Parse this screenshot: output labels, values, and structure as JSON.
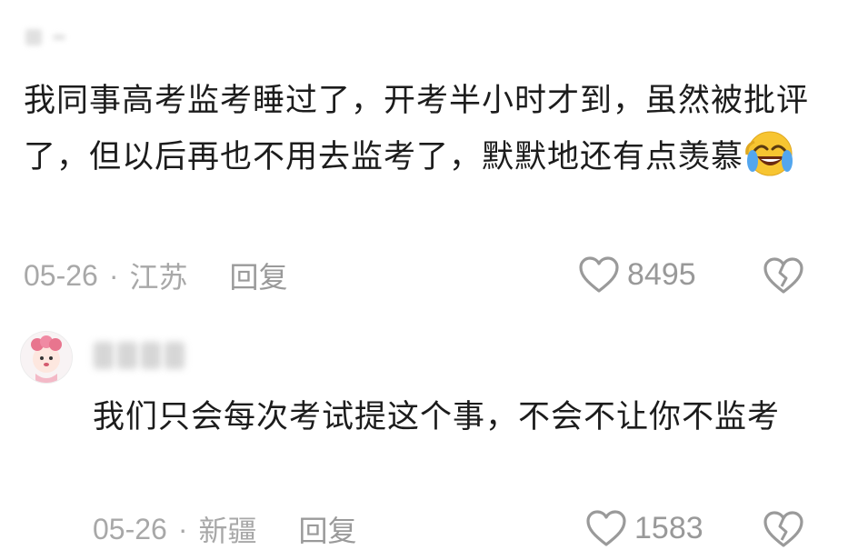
{
  "comment1": {
    "text": "我同事高考监考睡过了，开考半小时才到，虽然被批评了，但以后再也不用去监考了，默默地还有点羡慕",
    "date": "05-26",
    "separator": "·",
    "location": "江苏",
    "reply_label": "回复",
    "like_count": "8495",
    "emoji_icon": "laughing-crying-emoji"
  },
  "comment2": {
    "text": "我们只会每次考试提这个事，不会不让你不监考",
    "date": "05-26",
    "separator": "·",
    "location": "新疆",
    "reply_label": "回复",
    "like_count": "1583"
  },
  "icons": {
    "like": "heart-icon",
    "dislike": "broken-heart-icon"
  },
  "colors": {
    "text": "#1c1c1c",
    "meta": "#a8a8a8",
    "emoji": "#f7c531"
  }
}
